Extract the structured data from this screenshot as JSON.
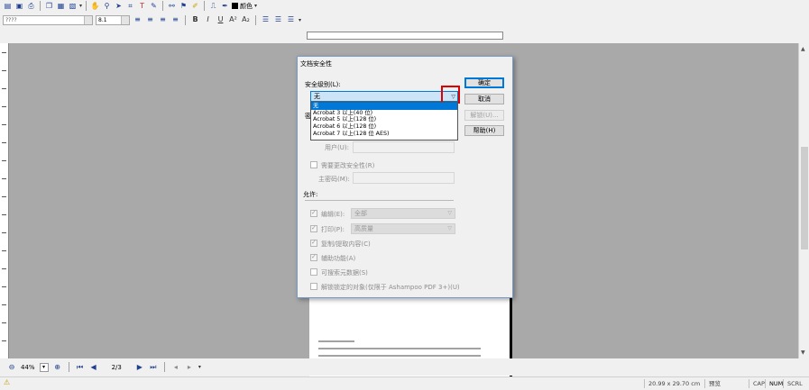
{
  "toolbar": {
    "font_name": "????",
    "font_size": "8.1",
    "color_label": "颜色"
  },
  "dialog": {
    "title": "文档安全性",
    "security_level_label": "安全级别(L):",
    "security_level_value": "无",
    "options": [
      "无",
      "Acrobat 3 以上(40 位)",
      "Acrobat 5 以上(128 位)",
      "Acrobat 6 以上(128 位)",
      "Acrobat 7 以上(128 位 AES)"
    ],
    "password_section_prefix": "密",
    "user_label": "用户(U):",
    "require_change_label": "需要更改安全性(R)",
    "master_password_label": "主密码(M):",
    "permissions_label": "允许:",
    "edit_label": "编辑(E):",
    "edit_value": "全部",
    "print_label": "打印(P):",
    "print_value": "高质量",
    "copy_label": "复制/提取内容(C)",
    "accessibility_label": "辅助功能(A)",
    "metadata_label": "可搜索元数据(S)",
    "decrypt_label": "解锁锁定的对象(仅限于 Ashampoo PDF 3+)(U)",
    "ok_button": "确定",
    "cancel_button": "取消",
    "unlock_button": "解锁(U)...",
    "help_button": "帮助(H)"
  },
  "navbar": {
    "zoom": "44%",
    "page": "2/3"
  },
  "statusbar": {
    "dimensions": "20.99 x 29.70 cm",
    "mode": "预览",
    "cap": "CAP",
    "num": "NUM",
    "scrl": "SCRL"
  }
}
